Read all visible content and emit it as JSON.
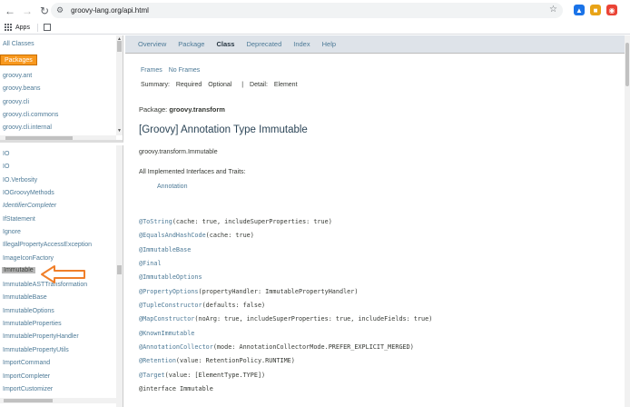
{
  "browser": {
    "url": "groovy-lang.org/api.html",
    "bookmarks": {
      "apps_label": "Apps"
    }
  },
  "left_top": {
    "all_classes": "All Classes",
    "packages_badge": "Packages",
    "packages": [
      "groovy.ant",
      "groovy.beans",
      "groovy.cli",
      "groovy.cli.commons",
      "groovy.cli.internal"
    ]
  },
  "left_bottom": {
    "classes": [
      "IO",
      "IO",
      "IO.Verbosity",
      "IOGroovyMethods",
      "IdentifierCompleter",
      "IfStatement",
      "Ignore",
      "IllegalPropertyAccessException",
      "ImageIconFactory",
      "Immutable",
      "ImmutableASTTransformation",
      "ImmutableBase",
      "ImmutableOptions",
      "ImmutableProperties",
      "ImmutablePropertyHandler",
      "ImmutablePropertyUtils",
      "ImportCommand",
      "ImportCompleter",
      "ImportCustomizer"
    ]
  },
  "main": {
    "nav": [
      "Overview",
      "Package",
      "Class",
      "Deprecated",
      "Index",
      "Help"
    ],
    "frames": "Frames",
    "no_frames": "No Frames",
    "summary_label": "Summary:",
    "summary_required": "Required",
    "summary_optional": "Optional",
    "detail_sep": "|",
    "detail_label": "Detail:",
    "detail_element": "Element",
    "package_label": "Package:",
    "package_name": "groovy.transform",
    "title": "[Groovy] Annotation Type Immutable",
    "qualified_name": "groovy.transform.Immutable",
    "interfaces_label": "All Implemented Interfaces and Traits:",
    "interface_link": "Annotation",
    "code": [
      {
        "ann": "@ToString",
        "rest": "(cache: true, includeSuperProperties: true)"
      },
      {
        "ann": "@EqualsAndHashCode",
        "rest": "(cache: true)"
      },
      {
        "ann": "@ImmutableBase",
        "rest": ""
      },
      {
        "ann": "@Final",
        "rest": ""
      },
      {
        "ann": "@ImmutableOptions",
        "rest": ""
      },
      {
        "ann": "@PropertyOptions",
        "rest": "(propertyHandler: ImmutablePropertyHandler)"
      },
      {
        "ann": "@TupleConstructor",
        "rest": "(defaults: false)"
      },
      {
        "ann": "@MapConstructor",
        "rest": "(noArg: true, includeSuperProperties: true, includeFields: true)"
      },
      {
        "ann": "@KnownImmutable",
        "rest": ""
      },
      {
        "ann": "@AnnotationCollector",
        "rest": "(mode: AnnotationCollectorMode.PREFER_EXPLICIT_MERGED)"
      },
      {
        "ann": "@Retention",
        "rest": "(value: RetentionPolicy.RUNTIME)"
      },
      {
        "ann": "@Target",
        "rest": "(value: [ElementType.TYPE])"
      },
      {
        "ann": "",
        "rest": "@interface Immutable"
      }
    ]
  },
  "colors": {
    "link": "#4d7a97",
    "nav_bg": "#dee3e9",
    "badge": "#f8981d",
    "selected": "#b8b8b8",
    "callout_arrow": "#f07f2a"
  }
}
